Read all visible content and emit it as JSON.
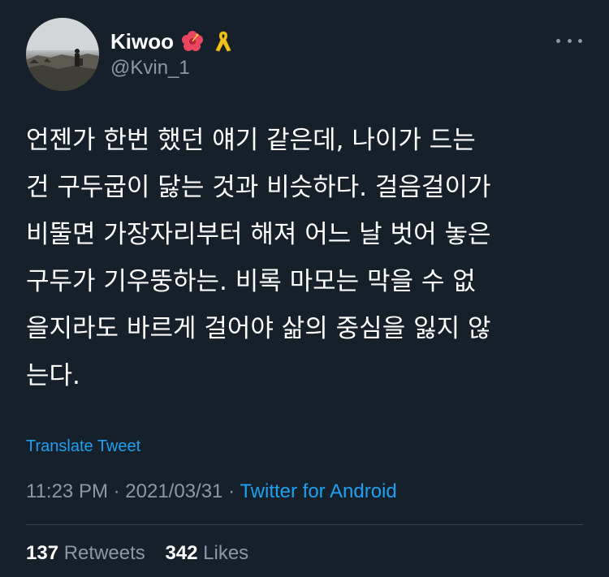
{
  "user": {
    "display_name": "Kiwoo",
    "handle": "@Kvin_1",
    "name_emojis": [
      "hibiscus-emoji",
      "yellow-ribbon-emoji"
    ]
  },
  "tweet": {
    "text": "언젠가 한번 했던 얘기 같은데, 나이가 드는\n건 구두굽이 닳는 것과 비슷하다. 걸음걸이가\n비뚤면 가장자리부터 해져 어느 날 벗어 놓은\n구두가 기우뚱하는. 비록 마모는 막을 수 없\n을지라도 바르게 걸어야 삶의 중심을 잃지 않\n는다.",
    "translate_label": "Translate Tweet"
  },
  "meta": {
    "time": "11:23 PM",
    "separator": " · ",
    "date": "2021/03/31",
    "source": "Twitter for Android"
  },
  "stats": {
    "retweets_count": "137",
    "retweets_label": "Retweets",
    "likes_count": "342",
    "likes_label": "Likes"
  },
  "colors": {
    "background": "#15202b",
    "accent": "#1da1f2",
    "secondary_text": "#8899a6",
    "divider": "#38444d"
  }
}
